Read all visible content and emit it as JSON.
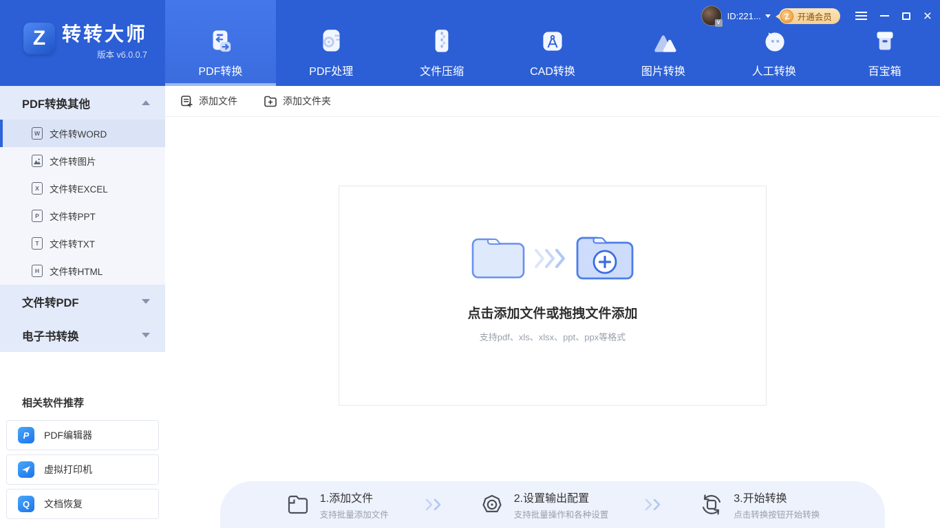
{
  "app": {
    "logo_letter": "Z",
    "title": "转转大师",
    "version": "版本 v6.0.0.7"
  },
  "titlebar": {
    "user_id": "ID:221...",
    "avatar_badge": "V",
    "vip": {
      "coin_letter": "Z",
      "label": "开通会员"
    }
  },
  "nav": {
    "tabs": [
      {
        "label": "PDF转换",
        "active": true
      },
      {
        "label": "PDF处理"
      },
      {
        "label": "文件压缩"
      },
      {
        "label": "CAD转换"
      },
      {
        "label": "图片转换"
      },
      {
        "label": "人工转换"
      },
      {
        "label": "百宝箱"
      }
    ]
  },
  "sidebar": {
    "groups": [
      {
        "label": "PDF转换其他",
        "state": "expanded"
      },
      {
        "label": "文件转PDF",
        "state": "collapsed"
      },
      {
        "label": "电子书转换",
        "state": "collapsed"
      }
    ],
    "items": [
      {
        "label": "文件转WORD",
        "badge": "W",
        "active": true
      },
      {
        "label": "文件转图片",
        "badge": ""
      },
      {
        "label": "文件转EXCEL",
        "badge": "X"
      },
      {
        "label": "文件转PPT",
        "badge": "P"
      },
      {
        "label": "文件转TXT",
        "badge": "T"
      },
      {
        "label": "文件转HTML",
        "badge": "H"
      }
    ],
    "related": {
      "heading": "相关软件推荐",
      "apps": [
        {
          "label": "PDF编辑器",
          "icon_letter": "P"
        },
        {
          "label": "虚拟打印机",
          "icon_letter": ""
        },
        {
          "label": "文档恢复",
          "icon_letter": "Q"
        }
      ]
    }
  },
  "toolbar": {
    "add_file": "添加文件",
    "add_folder": "添加文件夹"
  },
  "dropzone": {
    "title": "点击添加文件或拖拽文件添加",
    "subtitle": "支持pdf、xls、xlsx、ppt、ppx等格式"
  },
  "steps": [
    {
      "title": "1.添加文件",
      "desc": "支持批量添加文件"
    },
    {
      "title": "2.设置输出配置",
      "desc": "支持批量操作和各种设置"
    },
    {
      "title": "3.开始转换",
      "desc": "点击转换按钮开始转换"
    }
  ],
  "colors": {
    "header_blue": "#2c5fd5",
    "active_tab_blue": "#3e70e2",
    "active_tab_underline": "#9cb8f1",
    "accent_blue": "#2e63da",
    "sidebar_group_bg": "#e3eafa",
    "sidebar_items_bg": "#f4f6fc",
    "active_item_bg": "#dbe3f6",
    "steps_panel_bg": "#edf2fc",
    "vip_gold": "#f6d093",
    "vip_text": "#8a5516"
  }
}
